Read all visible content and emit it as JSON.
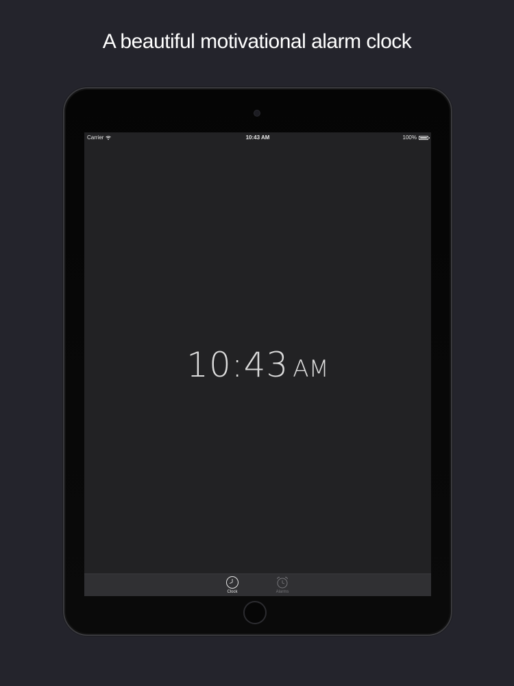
{
  "headline": "A beautiful motivational alarm clock",
  "status_bar": {
    "carrier": "Carrier",
    "time": "10:43 AM",
    "battery": "100%"
  },
  "clock": {
    "time": "10:43",
    "ampm": "AM"
  },
  "tabs": [
    {
      "label": "Clock",
      "icon": "clock-icon",
      "active": true
    },
    {
      "label": "Alarms",
      "icon": "alarm-icon",
      "active": false
    }
  ],
  "colors": {
    "background": "#24242c",
    "screen": "#222224",
    "tab_bar": "#303033",
    "active_tab": "#e6e6e6",
    "inactive_tab": "#77777b"
  }
}
